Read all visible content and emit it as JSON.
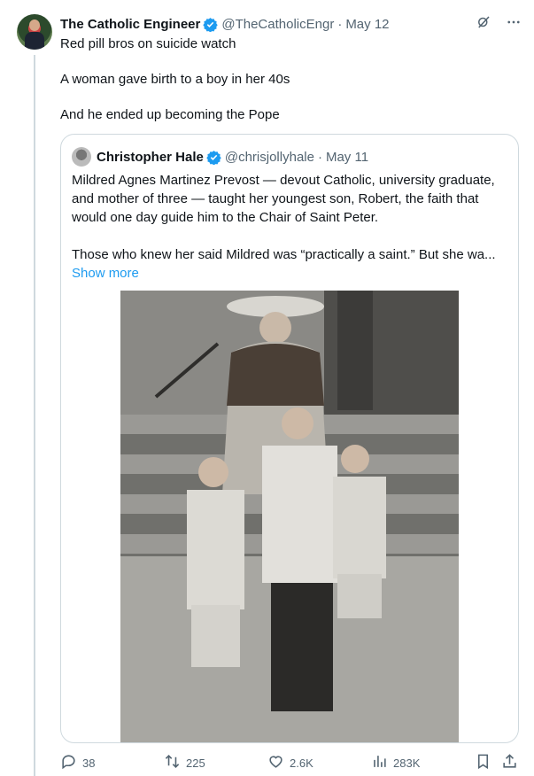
{
  "tweet": {
    "author_name": "The Catholic Engineer",
    "handle": "@TheCatholicEngr",
    "separator": "·",
    "date": "May 12",
    "lines": [
      "Red pill bros on suicide watch",
      "A woman gave birth to a boy in her 40s",
      "And he ended up becoming the Pope"
    ]
  },
  "quote": {
    "author_name": "Christopher Hale",
    "handle": "@chrisjollyhale",
    "separator": "·",
    "date": "May 11",
    "paragraph1": "Mildred Agnes Martinez Prevost — devout Catholic, university graduate, and mother of three — taught her youngest son, Robert, the faith that would one day guide him to the Chair of Saint Peter.",
    "paragraph2": "Those who knew her said Mildred was “practically a saint.” But she wa...",
    "show_more": "Show more"
  },
  "actions": {
    "replies": "38",
    "reposts": "225",
    "likes": "2.6K",
    "views": "283K"
  },
  "colors": {
    "accent": "#1d9bf0",
    "text": "#0f1419",
    "muted": "#536471",
    "border": "#cfd9de"
  },
  "icons": [
    "verified-badge-icon",
    "grok-icon",
    "more-icon",
    "reply-icon",
    "repost-icon",
    "like-icon",
    "views-icon",
    "bookmark-icon",
    "share-icon"
  ]
}
